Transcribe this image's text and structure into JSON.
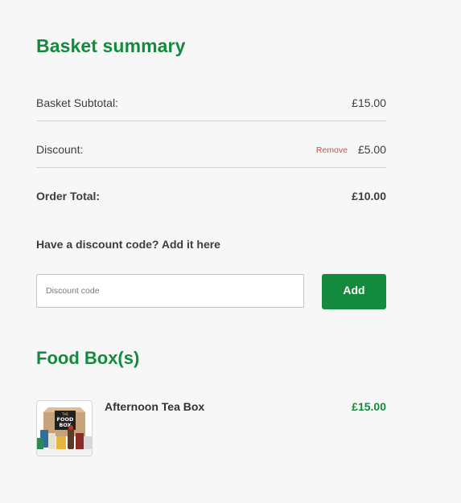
{
  "summary": {
    "title": "Basket summary",
    "subtotal_label": "Basket Subtotal:",
    "subtotal_value": "£15.00",
    "discount_label": "Discount:",
    "remove_label": "Remove",
    "discount_value": "£5.00",
    "total_label": "Order Total:",
    "total_value": "£10.00"
  },
  "discount_code": {
    "prompt": "Have a discount code? Add it here",
    "placeholder": "Discount code",
    "value": "",
    "add_label": "Add"
  },
  "food_boxes": {
    "title": "Food Box(s)",
    "items": [
      {
        "name": "Afternoon Tea Box",
        "price": "£15.00",
        "image_icon": "food-box-product-image",
        "image_text": "THE FOOD BOX"
      }
    ]
  },
  "colors": {
    "brand_green": "#138a3d",
    "remove_red": "#c4524e",
    "background": "#f7f7f7"
  }
}
